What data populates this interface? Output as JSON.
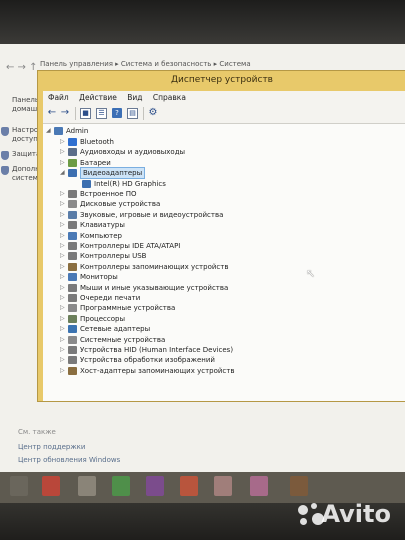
{
  "system_window": {
    "address": "Панель управления ▸ Система и безопасность ▸ Система",
    "left_items": [
      {
        "label": "Панель домашн"
      },
      {
        "label": "Настрой доступа"
      },
      {
        "label": "Защита"
      },
      {
        "label": "Дополн систем"
      }
    ],
    "see_also": "См. также",
    "links": [
      "Центр поддержки",
      "Центр обновления Windows"
    ]
  },
  "device_manager": {
    "title": "Диспетчер устройств",
    "menu": [
      "Файл",
      "Действие",
      "Вид",
      "Справка"
    ],
    "root": "Admin",
    "items": [
      {
        "label": "Bluetooth",
        "color": "#2f6fd0"
      },
      {
        "label": "Аудиовходы и аудиовыходы",
        "color": "#5b6e8a"
      },
      {
        "label": "Батареи",
        "color": "#6c9b45"
      },
      {
        "label": "Видеоадаптеры",
        "color": "#3d6fb0"
      },
      {
        "label": "Intel(R) HD Graphics",
        "color": "#3d6fb0"
      },
      {
        "label": "Встроенное ПО",
        "color": "#7a7a7a"
      },
      {
        "label": "Дисковые устройства",
        "color": "#8a8a8a"
      },
      {
        "label": "Звуковые, игровые и видеоустройства",
        "color": "#5a7da8"
      },
      {
        "label": "Клавиатуры",
        "color": "#7a7a7a"
      },
      {
        "label": "Компьютер",
        "color": "#4a79b5"
      },
      {
        "label": "Контроллеры IDE ATA/ATAPI",
        "color": "#7a7a7a"
      },
      {
        "label": "Контроллеры USB",
        "color": "#7a7a7a"
      },
      {
        "label": "Контроллеры запоминающих устройств",
        "color": "#8a6e40"
      },
      {
        "label": "Мониторы",
        "color": "#4a79b5"
      },
      {
        "label": "Мыши и иные указывающие устройства",
        "color": "#7a7a7a"
      },
      {
        "label": "Очереди печати",
        "color": "#7a7a7a"
      },
      {
        "label": "Программные устройства",
        "color": "#8a8a8a"
      },
      {
        "label": "Процессоры",
        "color": "#6b7f5a"
      },
      {
        "label": "Сетевые адаптеры",
        "color": "#3b73b0"
      },
      {
        "label": "Системные устройства",
        "color": "#8a8a8a"
      },
      {
        "label": "Устройства HID (Human Interface Devices)",
        "color": "#7a7a7a"
      },
      {
        "label": "Устройства обработки изображений",
        "color": "#7a7a7a"
      },
      {
        "label": "Хост-адаптеры запоминающих устройств",
        "color": "#8a6e40"
      }
    ]
  },
  "colors": {
    "title_bar": "#e8c96a",
    "selection": "#cde3f7"
  }
}
